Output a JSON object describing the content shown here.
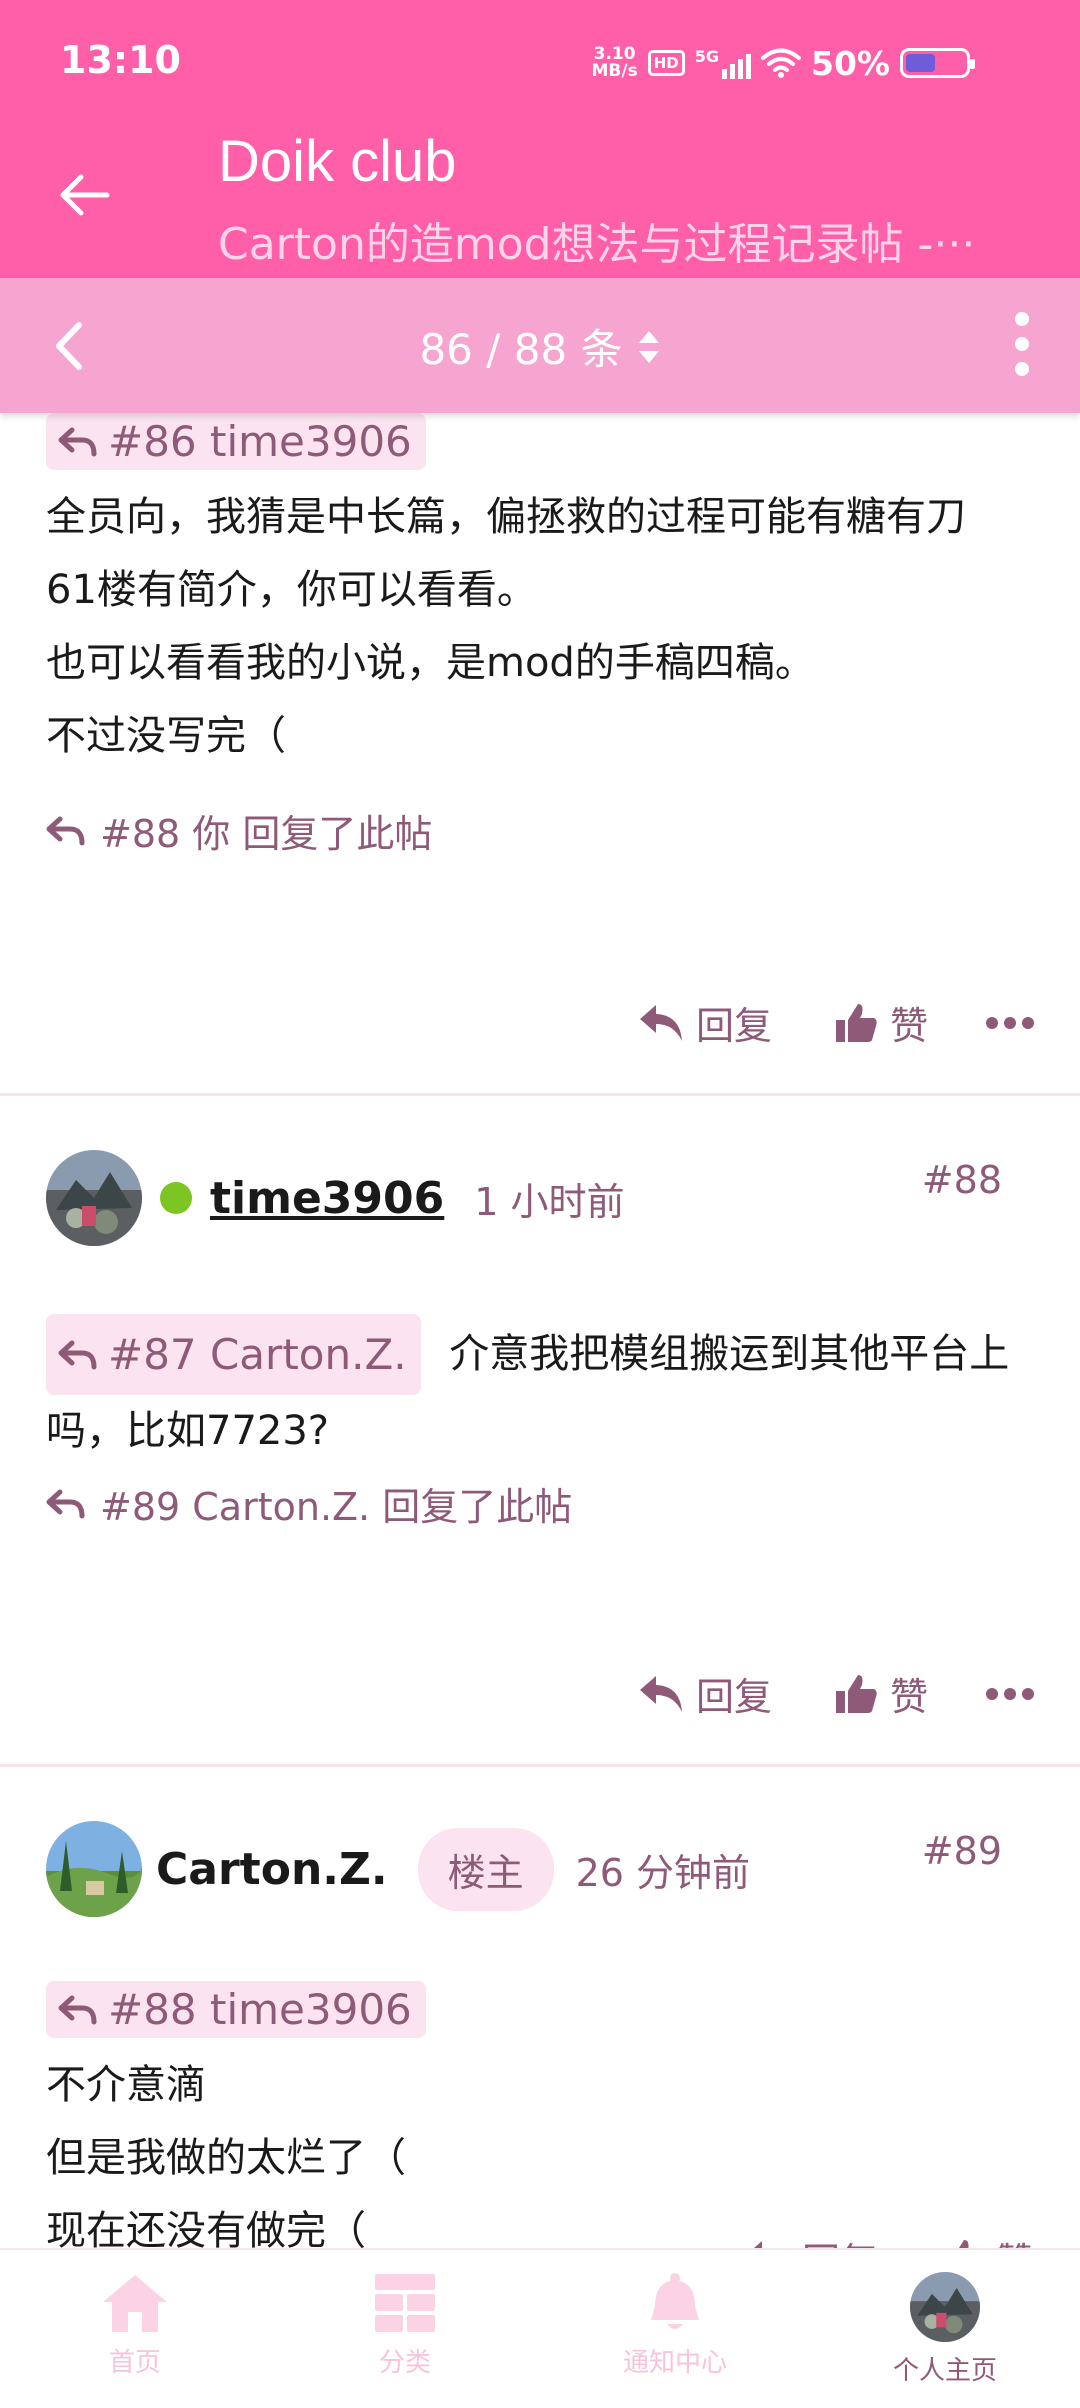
{
  "status_bar": {
    "time": "13:10",
    "net_speed_value": "3.10",
    "net_speed_unit": "MB/s",
    "hd_label": "HD",
    "signal_label": "5G",
    "battery": "50%",
    "battery_level": 0.5
  },
  "header": {
    "title": "Doik club",
    "subtitle": "Carton的造mod想法与过程记录帖 -···",
    "back_icon": "arrow-left-icon"
  },
  "pager": {
    "text": "86 / 88 条",
    "prev_icon": "chevron-left-icon",
    "sort_icon": "updown-caret-icon",
    "menu_icon": "more-vertical-icon"
  },
  "posts": [
    {
      "quote": "#86 time3906",
      "body": [
        "全员向，我猜是中长篇，偏拯救的过程可能有糖有刀",
        "61楼有简介，你可以看看。",
        "也可以看看我的小说，是mod的手稿四稿。",
        "不过没写完（"
      ],
      "reply_note": "#88 你 回复了此帖",
      "reply_label": "回复",
      "like_label": "赞"
    },
    {
      "author": "time3906",
      "time": "1 小时前",
      "floor": "#88",
      "quote": "#87 Carton.Z.",
      "body_inline": "介意我把模组搬运到其他平台上",
      "body_line2": "吗，比如7723?",
      "reply_note": "#89 Carton.Z. 回复了此帖",
      "reply_label": "回复",
      "like_label": "赞"
    },
    {
      "author": "Carton.Z.",
      "badge": "楼主",
      "time": "26 分钟前",
      "floor": "#89",
      "quote": "#88 time3906",
      "body": [
        "不介意滴",
        "但是我做的太烂了（",
        "现在还没有做完（"
      ],
      "reply_label": "回复",
      "like_label": "赞"
    }
  ],
  "bottom_nav": [
    {
      "label": "首页",
      "icon": "home-icon"
    },
    {
      "label": "分类",
      "icon": "grid-icon"
    },
    {
      "label": "通知中心",
      "icon": "bell-icon"
    },
    {
      "label": "个人主页",
      "icon": "avatar"
    }
  ],
  "colors": {
    "primary": "#ff5ea8",
    "secondary_bar": "#f5a5cf",
    "muted_text": "#8e5a78",
    "chip_bg": "#fbe4ef",
    "online": "#7cc522"
  }
}
